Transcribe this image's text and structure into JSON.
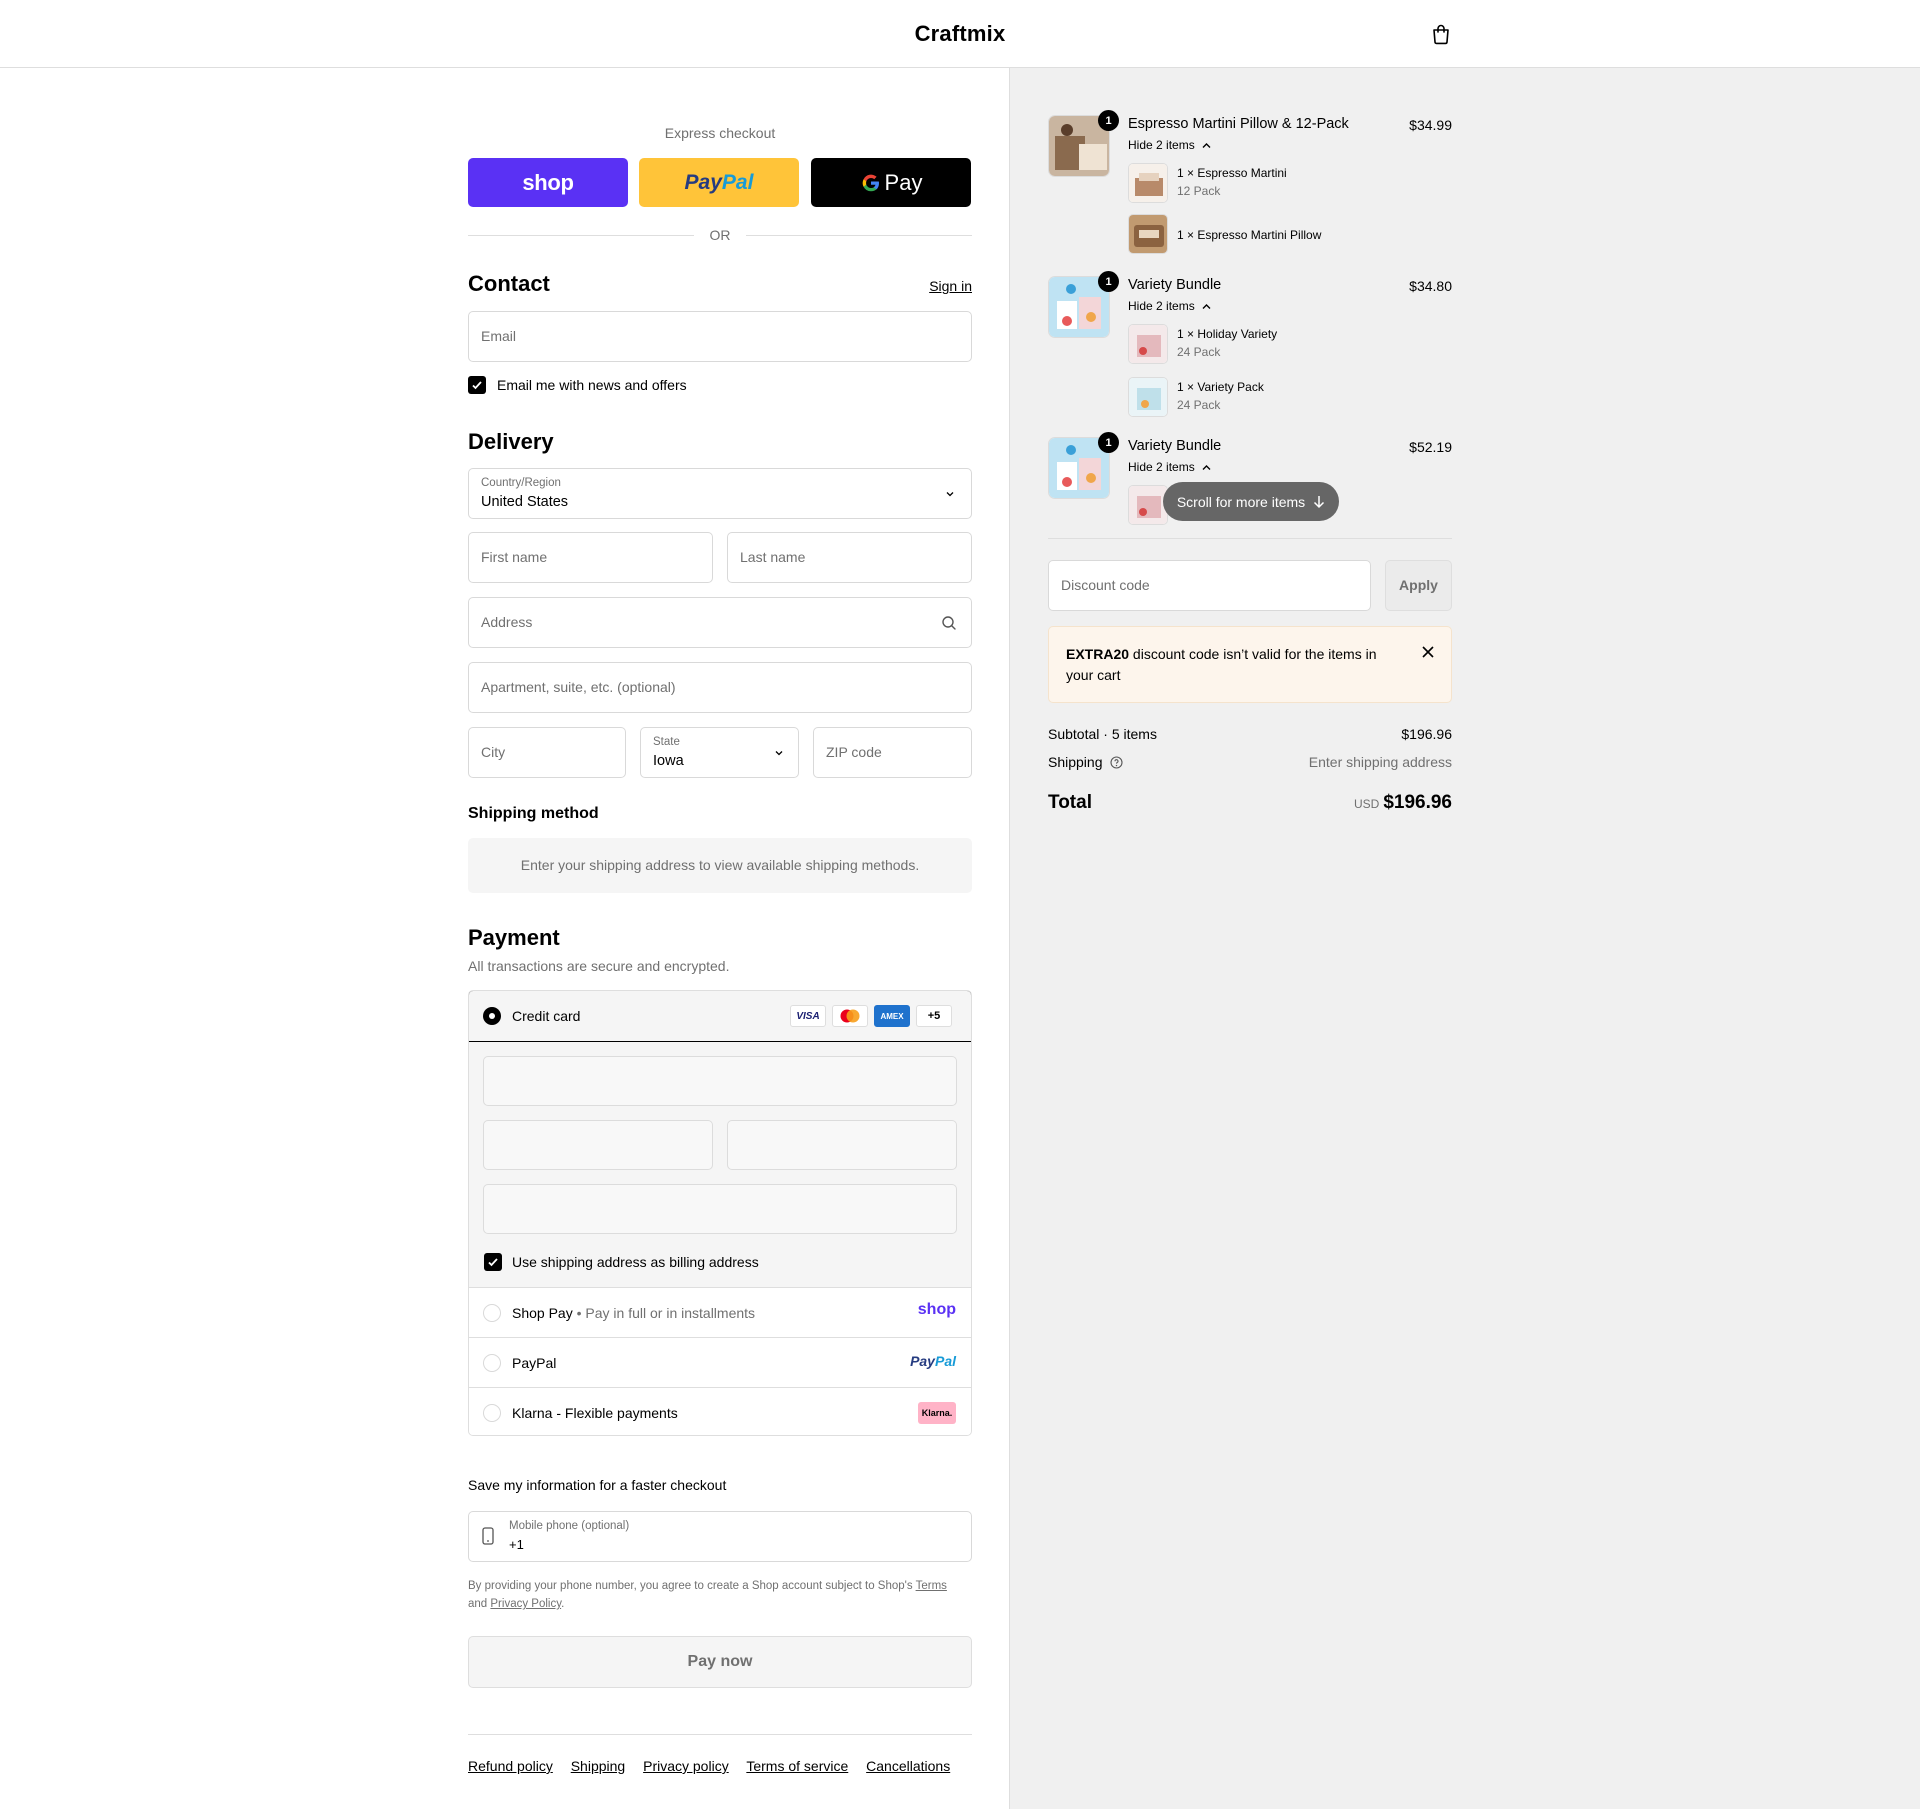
{
  "header": {
    "brand": "Craftmix"
  },
  "express": {
    "title": "Express checkout",
    "shop_label": "shop",
    "paypal_label": "PayPal",
    "gpay_label": "Pay",
    "or_label": "OR"
  },
  "contact": {
    "title": "Contact",
    "sign_in": "Sign in",
    "email_placeholder": "Email",
    "newsletter_label": "Email me with news and offers"
  },
  "delivery": {
    "title": "Delivery",
    "country_label": "Country/Region",
    "country_value": "United States",
    "first_name_placeholder": "First name",
    "last_name_placeholder": "Last name",
    "address_placeholder": "Address",
    "apartment_placeholder": "Apartment, suite, etc. (optional)",
    "city_placeholder": "City",
    "state_label": "State",
    "state_value": "Iowa",
    "zip_placeholder": "ZIP code"
  },
  "shipping_method": {
    "title": "Shipping method",
    "notice": "Enter your shipping address to view available shipping methods."
  },
  "payment": {
    "title": "Payment",
    "subtitle": "All transactions are secure and encrypted.",
    "credit_card_label": "Credit card",
    "cards": [
      "VISA",
      "mastercard",
      "AMEX",
      "+5"
    ],
    "billing_label": "Use shipping address as billing address",
    "shop_pay_label": "Shop Pay",
    "shop_pay_sub": "Pay in full or in installments",
    "shop_pay_logo": "shop",
    "paypal_label": "PayPal",
    "paypal_logo": "PayPal",
    "klarna_label": "Klarna - Flexible payments",
    "klarna_logo": "Klarna."
  },
  "save_info": {
    "title": "Save my information for a faster checkout",
    "phone_label": "Mobile phone (optional)",
    "phone_value": "+1",
    "legal_text": "By providing your phone number, you agree to create a Shop account subject to Shop's",
    "terms": "Terms",
    "and": "and",
    "privacy": "Privacy Policy",
    "period": "."
  },
  "pay_now": "Pay now",
  "footer": {
    "links": [
      "Refund policy",
      "Shipping",
      "Privacy policy",
      "Terms of service",
      "Cancellations"
    ]
  },
  "order": {
    "items": [
      {
        "qty": "1",
        "name": "Espresso Martini Pillow & 12-Pack",
        "price": "$34.99",
        "toggle": "Hide 2 items",
        "subs": [
          {
            "name": "1 × Espresso Martini",
            "variant": "12 Pack"
          },
          {
            "name": "1 × Espresso Martini Pillow",
            "variant": ""
          }
        ]
      },
      {
        "qty": "1",
        "name": "Variety Bundle",
        "price": "$34.80",
        "toggle": "Hide 2 items",
        "subs": [
          {
            "name": "1 × Holiday Variety",
            "variant": "24 Pack"
          },
          {
            "name": "1 × Variety Pack",
            "variant": "24 Pack"
          }
        ]
      },
      {
        "qty": "1",
        "name": "Variety Bundle",
        "price": "$52.19",
        "toggle": "Hide 2 items",
        "subs": []
      }
    ],
    "scroll_pill": "Scroll for more items",
    "discount_placeholder": "Discount code",
    "apply": "Apply",
    "alert_code": "EXTRA20",
    "alert_text": "discount code isn’t valid for the items in your cart",
    "subtotal_label": "Subtotal · 5 items",
    "subtotal_value": "$196.96",
    "shipping_label": "Shipping",
    "shipping_value": "Enter shipping address",
    "total_label": "Total",
    "currency": "USD",
    "total_value": "$196.96"
  },
  "colors": {
    "shop_purple": "#5a31f4",
    "paypal_yellow": "#ffc439",
    "gpay_black": "#000000",
    "amex_blue": "#1f72cd",
    "klarna_pink": "#ffb3c7",
    "alert_bg": "#fdf5ec"
  }
}
